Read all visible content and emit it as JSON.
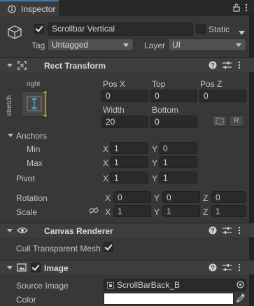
{
  "window": {
    "tab_title": "Inspector"
  },
  "header": {
    "object_name": "Scrollbar Vertical",
    "static_label": "Static",
    "tag_label": "Tag",
    "tag_value": "Untagged",
    "layer_label": "Layer",
    "layer_value": "UI"
  },
  "rect_transform": {
    "title": "Rect Transform",
    "anchor_preset_h": "right",
    "anchor_preset_v": "stretch",
    "col1": "Pos X",
    "col2": "Top",
    "col3": "Pos Z",
    "pos_x": "0",
    "top": "0",
    "pos_z": "0",
    "width_label": "Width",
    "bottom_label": "Bottom",
    "width": "20",
    "bottom": "0",
    "r_button": "R",
    "anchors_label": "Anchors",
    "min_label": "Min",
    "min_x": "1",
    "min_y": "0",
    "max_label": "Max",
    "max_x": "1",
    "max_y": "1",
    "pivot_label": "Pivot",
    "pivot_x": "1",
    "pivot_y": "1",
    "rotation_label": "Rotation",
    "rot_x": "0",
    "rot_y": "0",
    "rot_z": "0",
    "scale_label": "Scale",
    "scale_x": "1",
    "scale_y": "1",
    "scale_z": "1",
    "x": "X",
    "y": "Y",
    "z": "Z"
  },
  "canvas_renderer": {
    "title": "Canvas Renderer",
    "cull_label": "Cull Transparent Mesh"
  },
  "image": {
    "title": "Image",
    "source_label": "Source Image",
    "source_value": "ScrollBarBack_B",
    "color_label": "Color"
  },
  "colors": {
    "accent": "#3a79bb",
    "background": "#383838",
    "field": "#2a2a2a",
    "anchor_orange": "#e0a23a",
    "anchor_blue": "#4aa6e8"
  }
}
